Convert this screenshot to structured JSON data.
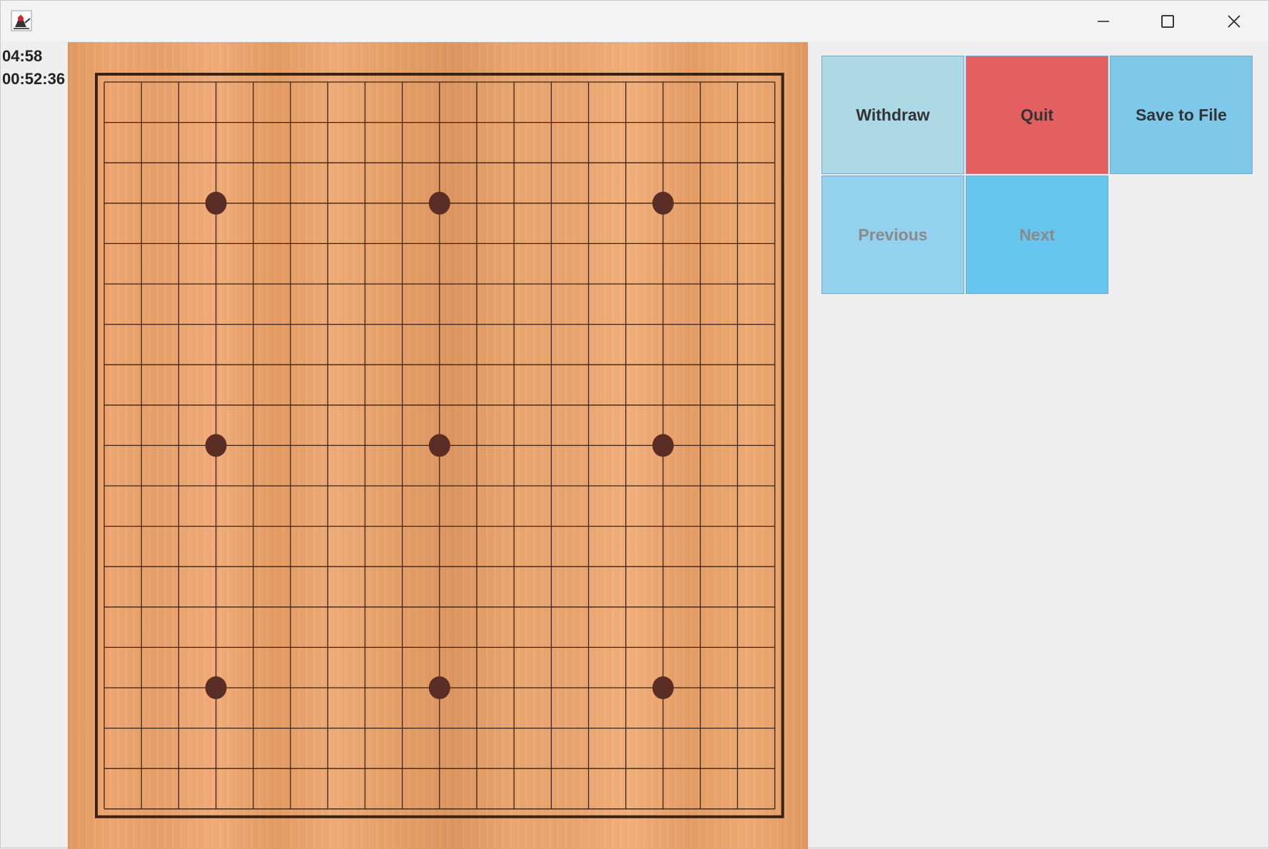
{
  "window": {
    "app_icon": "java-duke-icon",
    "controls": [
      "minimize-icon",
      "maximize-icon",
      "close-icon"
    ]
  },
  "timers": {
    "move_timer": "04:58",
    "total_timer": "00:52:36"
  },
  "board": {
    "size": 19,
    "star_points": [
      [
        3,
        3
      ],
      [
        3,
        9
      ],
      [
        3,
        15
      ],
      [
        9,
        3
      ],
      [
        9,
        9
      ],
      [
        9,
        15
      ],
      [
        15,
        3
      ],
      [
        15,
        9
      ],
      [
        15,
        15
      ]
    ],
    "stones": [],
    "line_color": "#3a2214",
    "star_color": "#5a2e24",
    "wood_color": "#e8a46e"
  },
  "buttons": {
    "withdraw": {
      "label": "Withdraw",
      "color": "#add8e6",
      "enabled": true
    },
    "quit": {
      "label": "Quit",
      "color": "#e45f5f",
      "enabled": true
    },
    "save": {
      "label": "Save to File",
      "color": "#7ec8ea",
      "enabled": true
    },
    "previous": {
      "label": "Previous",
      "color": "#93d1ef",
      "enabled": false
    },
    "next": {
      "label": "Next",
      "color": "#66c6ee",
      "enabled": false
    }
  }
}
